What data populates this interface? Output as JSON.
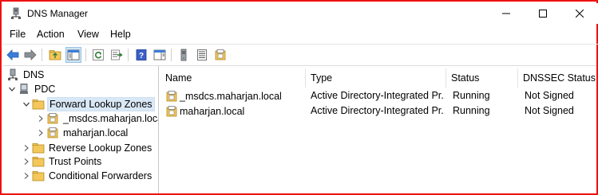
{
  "window": {
    "title": "DNS Manager"
  },
  "menu": [
    "File",
    "Action",
    "View",
    "Help"
  ],
  "tree": {
    "root": "DNS",
    "server": "PDC",
    "forward": "Forward Lookup Zones",
    "zone1": "_msdcs.maharjan.local",
    "zone2": "maharjan.local",
    "reverse": "Reverse Lookup Zones",
    "trust": "Trust Points",
    "conditional": "Conditional Forwarders"
  },
  "list": {
    "columns": [
      "Name",
      "Type",
      "Status",
      "DNSSEC Status"
    ],
    "rows": [
      [
        "_msdcs.maharjan.local",
        "Active Directory-Integrated Pr...",
        "Running",
        "Not Signed"
      ],
      [
        "maharjan.local",
        "Active Directory-Integrated Pr...",
        "Running",
        "Not Signed"
      ]
    ]
  },
  "colors": {
    "frame_border": "#ee1111",
    "selection": "#d9e8f6",
    "folder": "#f3c75a"
  }
}
